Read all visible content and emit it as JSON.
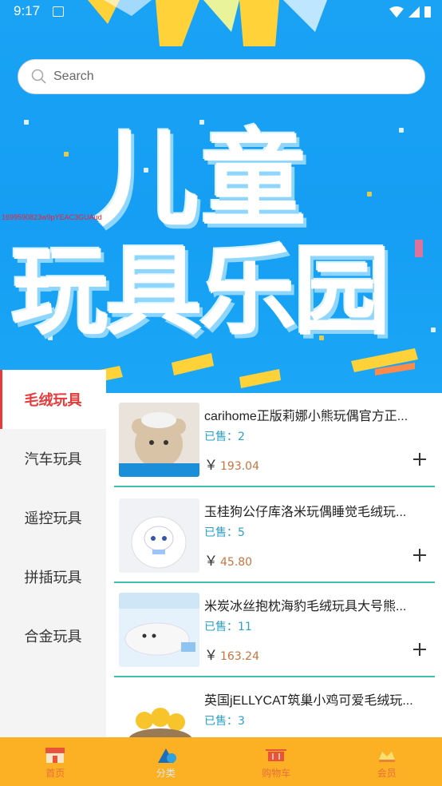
{
  "status_bar": {
    "time": "9:17"
  },
  "search": {
    "placeholder": "Search"
  },
  "banner": {
    "title_line1": "儿童",
    "title_line2": "玩具乐园",
    "watermark": "1699590823w9pYEAC3GUAud"
  },
  "categories": [
    {
      "label": "毛绒玩具",
      "active": true
    },
    {
      "label": "汽车玩具",
      "active": false
    },
    {
      "label": "遥控玩具",
      "active": false
    },
    {
      "label": "拼插玩具",
      "active": false
    },
    {
      "label": "合金玩具",
      "active": false
    }
  ],
  "products": [
    {
      "name": "carihome正版莉娜小熊玩偶官方正...",
      "sold": "已售：2",
      "currency": "￥",
      "price": "193.04"
    },
    {
      "name": "玉桂狗公仔库洛米玩偶睡觉毛绒玩...",
      "sold": "已售：5",
      "currency": "￥",
      "price": "45.80"
    },
    {
      "name": "米炭冰丝抱枕海豹毛绒玩具大号熊...",
      "sold": "已售：11",
      "currency": "￥",
      "price": "163.24"
    },
    {
      "name": "英国jELLYCAT筑巢小鸡可爱毛绒玩...",
      "sold": "已售：3",
      "currency": "￥",
      "price": ""
    }
  ],
  "tabs": [
    {
      "label": "首页",
      "icon": "shop-icon"
    },
    {
      "label": "分类",
      "icon": "category-icon"
    },
    {
      "label": "购物车",
      "icon": "cart-icon"
    },
    {
      "label": "会员",
      "icon": "member-icon"
    }
  ],
  "colors": {
    "accent": "#e83a3a",
    "tabbar": "#fcb024",
    "hero": "#1aa3f5",
    "divider": "#3fbfae"
  }
}
